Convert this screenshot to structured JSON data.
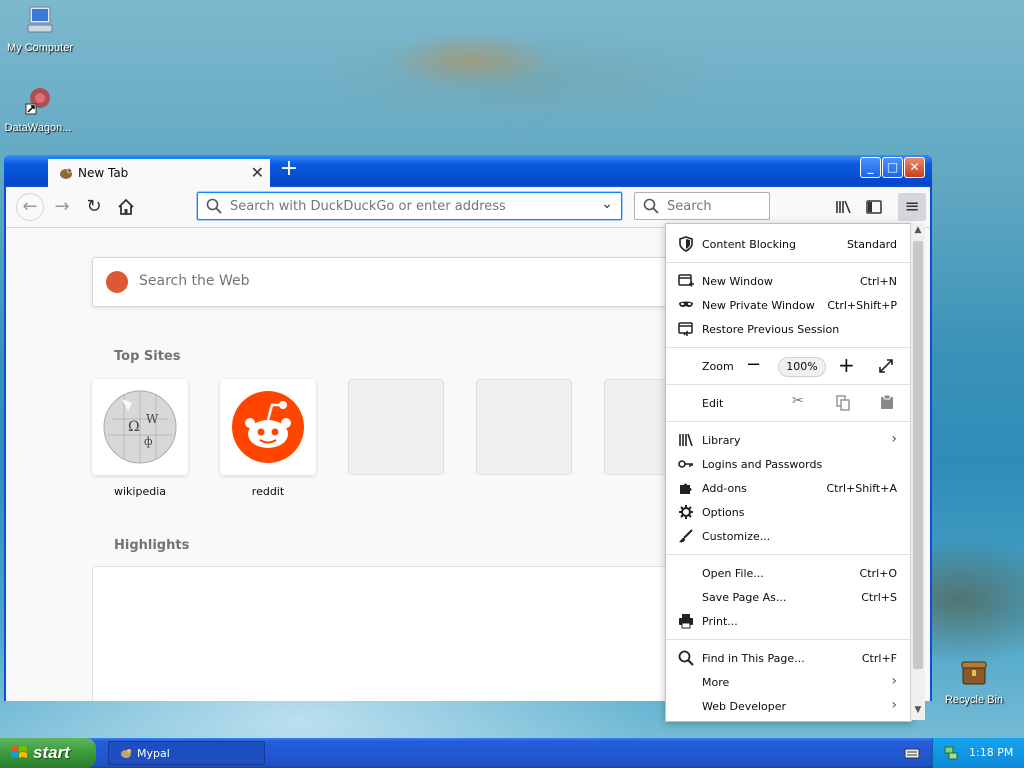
{
  "desktop": {
    "icons": [
      {
        "label": "My Computer"
      },
      {
        "label": "DataWagon..."
      },
      {
        "label": "Recycle Bin"
      }
    ]
  },
  "browser": {
    "tab": {
      "title": "New Tab"
    },
    "urlbar": {
      "placeholder": "Search with DuckDuckGo or enter address"
    },
    "searchbar": {
      "placeholder": "Search"
    },
    "newtab": {
      "search_placeholder": "Search the Web",
      "top_sites_title": "Top Sites",
      "top_sites": [
        {
          "label": "wikipedia"
        },
        {
          "label": "reddit"
        }
      ],
      "highlights_title": "Highlights"
    }
  },
  "menu": {
    "content_blocking": {
      "label": "Content Blocking",
      "value": "Standard"
    },
    "new_window": {
      "label": "New Window",
      "shortcut": "Ctrl+N"
    },
    "new_private_window": {
      "label": "New Private Window",
      "shortcut": "Ctrl+Shift+P"
    },
    "restore_session": {
      "label": "Restore Previous Session"
    },
    "zoom": {
      "label": "Zoom",
      "value": "100%"
    },
    "edit": {
      "label": "Edit"
    },
    "library": {
      "label": "Library"
    },
    "logins": {
      "label": "Logins and Passwords"
    },
    "addons": {
      "label": "Add-ons",
      "shortcut": "Ctrl+Shift+A"
    },
    "options": {
      "label": "Options"
    },
    "customize": {
      "label": "Customize..."
    },
    "open_file": {
      "label": "Open File...",
      "shortcut": "Ctrl+O"
    },
    "save_page": {
      "label": "Save Page As...",
      "shortcut": "Ctrl+S"
    },
    "print": {
      "label": "Print..."
    },
    "find": {
      "label": "Find in This Page...",
      "shortcut": "Ctrl+F"
    },
    "more": {
      "label": "More"
    },
    "web_developer": {
      "label": "Web Developer"
    }
  },
  "taskbar": {
    "start_label": "start",
    "task_label": "Mypal",
    "clock": "1:18 PM"
  },
  "colors": {
    "accent": "#0a84ff",
    "reddit": "#ff4500",
    "xp_blue": "#0b4fd6",
    "start_green": "#3c9a3c"
  }
}
